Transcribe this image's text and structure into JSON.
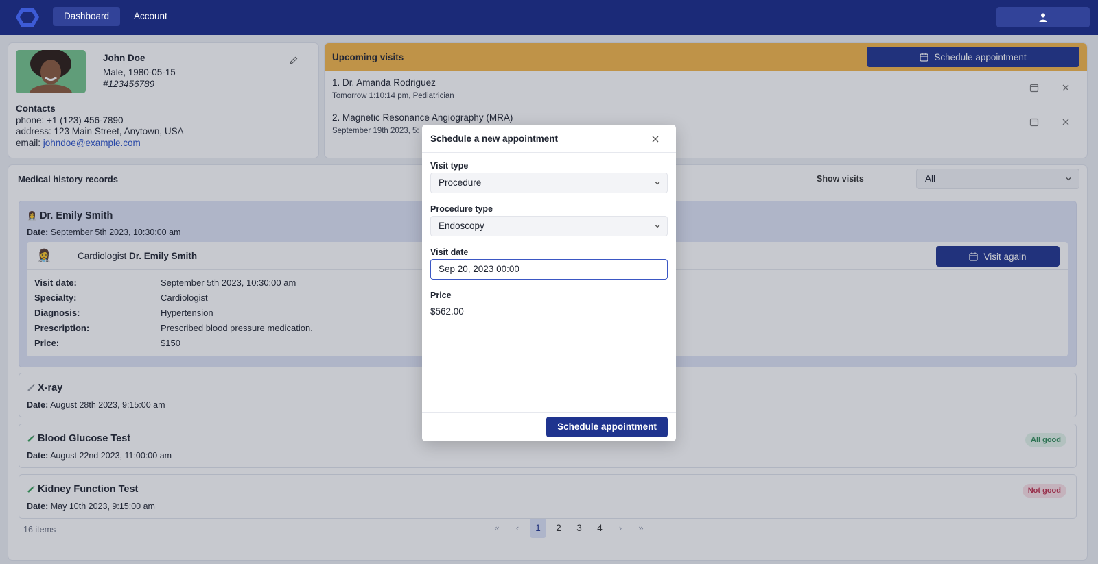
{
  "nav": {
    "tabs": [
      {
        "label": "Dashboard",
        "active": true
      },
      {
        "label": "Account",
        "active": false
      }
    ],
    "brand_color": "#1b2a78"
  },
  "patient": {
    "name": "John Doe",
    "gender_dob": "Male, 1980-05-15",
    "id": "#123456789",
    "contacts_heading": "Contacts",
    "phone": "phone: +1 (123) 456-7890",
    "address": "address: 123 Main Street, Anytown, USA",
    "email_label": "email: ",
    "email": "johndoe@example.com"
  },
  "upcoming": {
    "title": "Upcoming visits",
    "schedule_label": "Schedule appointment",
    "items": [
      {
        "title": "1. Dr. Amanda Rodriguez",
        "subtitle": "Tomorrow 1:10:14 pm, Pediatrician"
      },
      {
        "title": "2. Magnetic Resonance Angiography (MRA)",
        "subtitle": "September 19th 2023, 5:"
      }
    ]
  },
  "history": {
    "title": "Medical history records",
    "filter_label": "Show visits",
    "filter_value": "All",
    "records": [
      {
        "icon": "doctor-emoji",
        "title": "Dr. Emily Smith",
        "date_label": "Date:",
        "date": "September 5th 2023, 10:30:00 am",
        "specialty_prefix": "Cardiologist ",
        "doctor": "Dr. Emily Smith",
        "visit_again_label": "Visit again",
        "details": [
          {
            "key": "Visit date:",
            "value": "September 5th 2023, 10:30:00 am"
          },
          {
            "key": "Specialty:",
            "value": "Cardiologist"
          },
          {
            "key": "Diagnosis:",
            "value": "Hypertension"
          },
          {
            "key": "Prescription:",
            "value": "Prescribed blood pressure medication."
          },
          {
            "key": "Price:",
            "value": "$150"
          }
        ]
      },
      {
        "icon": "syringe-icon",
        "title": "X-ray",
        "date_label": "Date:",
        "date": "August 28th 2023, 9:15:00 am"
      },
      {
        "icon": "test-tube-icon",
        "title": "Blood Glucose Test",
        "date_label": "Date:",
        "date": "August 22nd 2023, 11:00:00 am",
        "badge": "All good",
        "badge_status": "good"
      },
      {
        "icon": "test-tube-icon",
        "title": "Kidney Function Test",
        "date_label": "Date:",
        "date": "May 10th 2023, 9:15:00 am",
        "badge": "Not good",
        "badge_status": "bad"
      }
    ],
    "items_count": "16 items",
    "pagination": {
      "pages": [
        "1",
        "2",
        "3",
        "4"
      ],
      "current": "1"
    }
  },
  "modal": {
    "title": "Schedule a new appointment",
    "visit_type_label": "Visit type",
    "visit_type_value": "Procedure",
    "procedure_type_label": "Procedure type",
    "procedure_type_value": "Endoscopy",
    "visit_date_label": "Visit date",
    "visit_date_value": "Sep 20, 2023 00:00",
    "price_label": "Price",
    "price_value": "$562.00",
    "submit_label": "Schedule appointment"
  },
  "colors": {
    "accent": "#1f348f",
    "warning_header": "#f4b64a",
    "badge_good": "#2f8a57",
    "badge_bad": "#c0304d"
  }
}
